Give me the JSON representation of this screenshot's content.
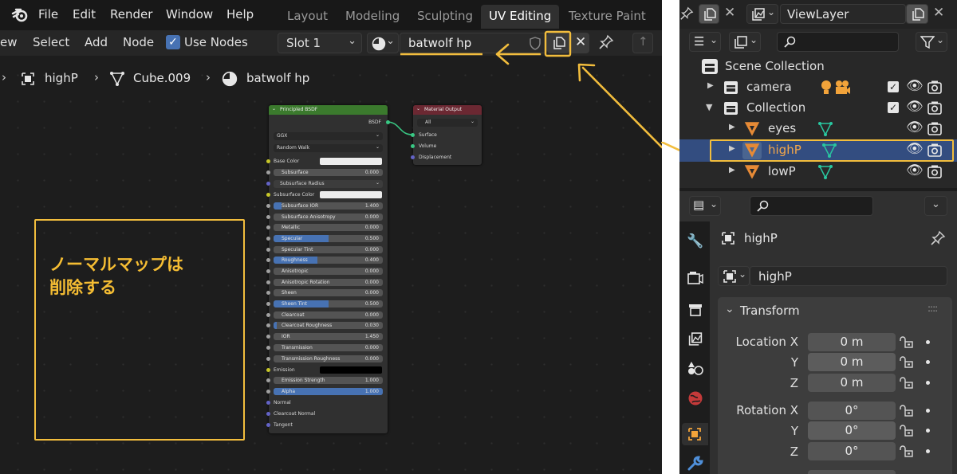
{
  "topbar": {
    "menus": [
      "File",
      "Edit",
      "Render",
      "Window",
      "Help"
    ],
    "workspaces": [
      "Layout",
      "Modeling",
      "Sculpting",
      "UV Editing",
      "Texture Paint"
    ],
    "active_workspace": "UV Editing"
  },
  "editor_header": {
    "view_label": "ew",
    "select_label": "Select",
    "add_label": "Add",
    "node_label": "Node",
    "use_nodes_label": "Use Nodes",
    "use_nodes_checked": true,
    "slot_label": "Slot 1",
    "material_name": "batwolf hp"
  },
  "breadcrumb": {
    "object": "highP",
    "mesh": "Cube.009",
    "material": "batwolf hp"
  },
  "bsdf_node": {
    "title": "Principled BSDF",
    "output_label": "BSDF",
    "distribution": "GGX",
    "subsurface_method": "Random Walk",
    "base_color_label": "Base Color",
    "subsurface_radius_label": "Subsurface Radius",
    "subsurface_color_label": "Subsurface Color",
    "emission_label": "Emission",
    "normal_label": "Normal",
    "clearcoat_normal_label": "Clearcoat Normal",
    "tangent_label": "Tangent",
    "sliders": [
      {
        "label": "Subsurface",
        "value": "0.000",
        "fraction": 0.0
      },
      {
        "label": "Subsurface IOR",
        "value": "1.400",
        "fraction": 0.07
      },
      {
        "label": "Subsurface Anisotropy",
        "value": "0.000",
        "fraction": 0.0
      },
      {
        "label": "Metallic",
        "value": "0.000",
        "fraction": 0.0
      },
      {
        "label": "Specular",
        "value": "0.500",
        "fraction": 0.5
      },
      {
        "label": "Specular Tint",
        "value": "0.000",
        "fraction": 0.0
      },
      {
        "label": "Roughness",
        "value": "0.400",
        "fraction": 0.4
      },
      {
        "label": "Anisotropic",
        "value": "0.000",
        "fraction": 0.0
      },
      {
        "label": "Anisotropic Rotation",
        "value": "0.000",
        "fraction": 0.0
      },
      {
        "label": "Sheen",
        "value": "0.000",
        "fraction": 0.0
      },
      {
        "label": "Sheen Tint",
        "value": "0.500",
        "fraction": 0.5
      },
      {
        "label": "Clearcoat",
        "value": "0.000",
        "fraction": 0.0
      },
      {
        "label": "Clearcoat Roughness",
        "value": "0.030",
        "fraction": 0.03
      },
      {
        "label": "IOR",
        "value": "1.450",
        "fraction": 0.0
      },
      {
        "label": "Transmission",
        "value": "0.000",
        "fraction": 0.0
      },
      {
        "label": "Transmission Roughness",
        "value": "0.000",
        "fraction": 0.0
      },
      {
        "label": "Emission Strength",
        "value": "1.000",
        "fraction": 0.0
      },
      {
        "label": "Alpha",
        "value": "1.000",
        "fraction": 1.0
      }
    ]
  },
  "output_node": {
    "title": "Material Output",
    "target": "All",
    "inputs": [
      "Surface",
      "Volume",
      "Displacement"
    ]
  },
  "annotation": {
    "text": "ノーマルマップは\n削除する"
  },
  "outliner": {
    "view_layer": "ViewLayer",
    "scene_collection": "Scene Collection",
    "items": [
      {
        "label": "camera"
      },
      {
        "label": "Collection"
      },
      {
        "label": "eyes"
      },
      {
        "label": "highP"
      },
      {
        "label": "lowP"
      }
    ]
  },
  "properties": {
    "object_name": "highP",
    "data_name": "highP",
    "transform_label": "Transform",
    "location_label": "Location X",
    "rotation_label": "Rotation X",
    "y_label": "Y",
    "z_label": "Z",
    "location": [
      "0 m",
      "0 m",
      "0 m"
    ],
    "rotation": [
      "0°",
      "0°",
      "0°"
    ]
  },
  "colors": {
    "annotation": "#f2bd3d",
    "selected_row": "#334d80",
    "bsdf_header": "#3b7a2d",
    "output_header": "#6b2832",
    "slider_fill": "#4772b3"
  }
}
